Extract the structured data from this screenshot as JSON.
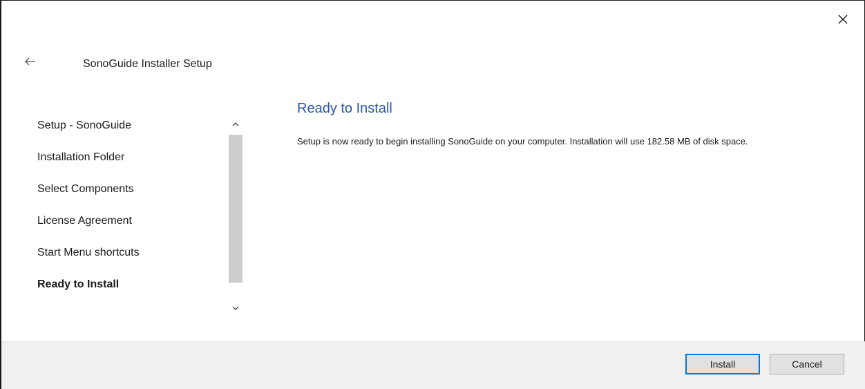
{
  "window": {
    "title": "SonoGuide Installer Setup"
  },
  "icons": {
    "close": "close-icon",
    "back": "back-arrow-icon",
    "scroll_up": "chevron-up-icon",
    "scroll_down": "chevron-down-icon"
  },
  "sidebar": {
    "items": [
      {
        "label": "Setup - SonoGuide",
        "active": false
      },
      {
        "label": "Installation Folder",
        "active": false
      },
      {
        "label": "Select Components",
        "active": false
      },
      {
        "label": "License Agreement",
        "active": false
      },
      {
        "label": "Start Menu shortcuts",
        "active": false
      },
      {
        "label": "Ready to Install",
        "active": true
      }
    ]
  },
  "content": {
    "heading": "Ready to Install",
    "message": "Setup is now ready to begin installing SonoGuide on your computer. Installation will use 182.58 MB of disk space."
  },
  "footer": {
    "install_label": "Install",
    "cancel_label": "Cancel"
  },
  "colors": {
    "heading": "#2b55a5",
    "primary_border": "#0078d7",
    "footer_bg": "#f0f0f0"
  }
}
